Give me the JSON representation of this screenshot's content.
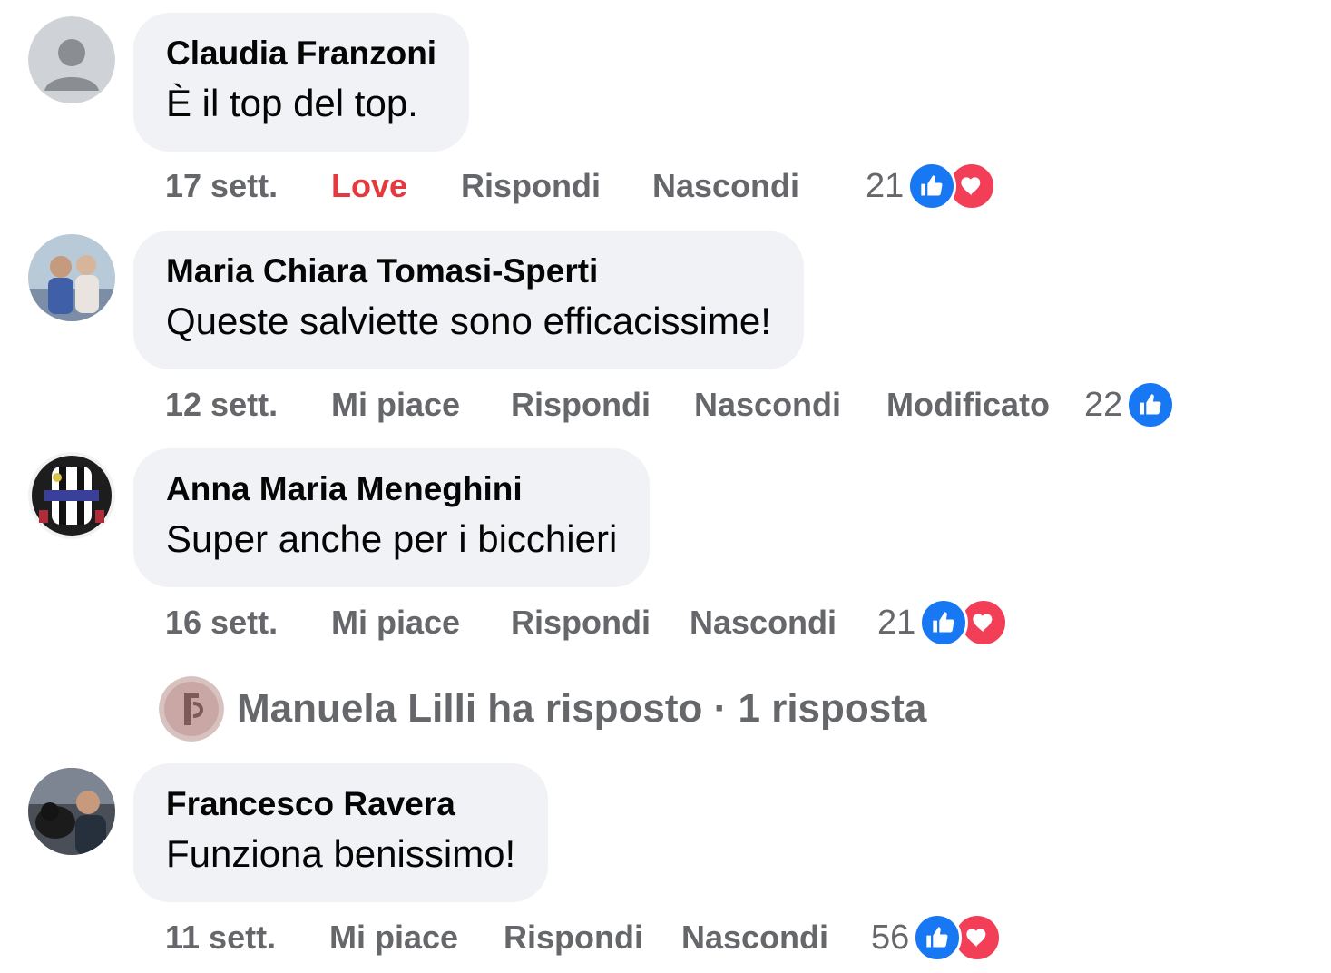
{
  "comments": [
    {
      "author": "Claudia Franzoni",
      "text": "È il top del top.",
      "time": "17 sett.",
      "like_label": "Love",
      "reply_label": "Rispondi",
      "hide_label": "Nascondi",
      "edited_label": "",
      "reaction_count": "21",
      "reactions": [
        "like-icon",
        "love-icon"
      ],
      "avatar": "default-avatar"
    },
    {
      "author": "Maria Chiara Tomasi-Sperti",
      "text": "Queste salviette sono efficacissime!",
      "time": "12 sett.",
      "like_label": "Mi piace",
      "reply_label": "Rispondi",
      "hide_label": "Nascondi",
      "edited_label": "Modificato",
      "reaction_count": "22",
      "reactions": [
        "like-icon"
      ],
      "avatar": "photo-avatar"
    },
    {
      "author": "Anna Maria Meneghini",
      "text": "Super anche per i bicchieri",
      "time": "16 sett.",
      "like_label": "Mi piace",
      "reply_label": "Rispondi",
      "hide_label": "Nascondi",
      "edited_label": "",
      "reaction_count": "21",
      "reactions": [
        "like-icon",
        "love-icon"
      ],
      "avatar": "crest-avatar"
    },
    {
      "author": "Francesco Ravera",
      "text": "Funziona benissimo!",
      "time": "11 sett.",
      "like_label": "Mi piace",
      "reply_label": "Rispondi",
      "hide_label": "Nascondi",
      "edited_label": "",
      "reaction_count": "56",
      "reactions": [
        "like-icon",
        "love-icon"
      ],
      "avatar": "photo-avatar"
    }
  ],
  "reply_summary": {
    "text": "Manuela Lilli ha risposto · 1 risposta"
  },
  "colors": {
    "bubble": "#f0f2f5",
    "meta_text": "#65676b",
    "love_text": "#e4393f",
    "like_blue": "#1877f2",
    "love_red": "#f33e58"
  }
}
